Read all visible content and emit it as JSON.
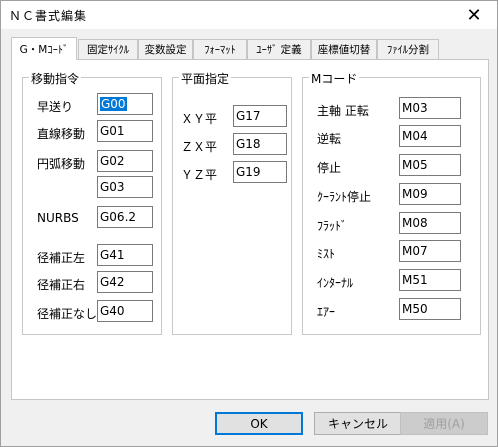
{
  "window": {
    "title": "ＮＣ書式編集"
  },
  "tabs": [
    "G・Mｺｰﾄﾞ",
    "固定ｻｲｸﾙ",
    "変数設定",
    "ﾌｫｰﾏｯﾄ",
    "ﾕｰｻﾞ 定義",
    "座標値切替",
    "ﾌｧｲﾙ分割"
  ],
  "movement": {
    "legend": "移動指令",
    "rapid": {
      "label": "早送り",
      "value": "G00"
    },
    "linear": {
      "label": "直線移動",
      "value": "G01"
    },
    "arc": {
      "label": "円弧移動",
      "value1": "G02",
      "value2": "G03"
    },
    "nurbs": {
      "label": "NURBS",
      "value": "G06.2"
    },
    "comp_left": {
      "label": "径補正左",
      "value": "G41"
    },
    "comp_right": {
      "label": "径補正右",
      "value": "G42"
    },
    "comp_none": {
      "label": "径補正なし",
      "value": "G40"
    }
  },
  "plane": {
    "legend": "平面指定",
    "xy": {
      "label": "ＸＹ平",
      "value": "G17"
    },
    "zx": {
      "label": "ＺＸ平",
      "value": "G18"
    },
    "yz": {
      "label": "ＹＺ平",
      "value": "G19"
    }
  },
  "mcode": {
    "legend": "Mコード",
    "spindle_cw": {
      "label": "主軸 正転",
      "value": "M03"
    },
    "spindle_ccw": {
      "label": "逆転",
      "value": "M04"
    },
    "stop": {
      "label": "停止",
      "value": "M05"
    },
    "coolant_stop": {
      "label": "ｸｰﾗﾝﾄ停止",
      "value": "M09"
    },
    "flood": {
      "label": "ﾌﾗｯﾄﾞ",
      "value": "M08"
    },
    "mist": {
      "label": "ﾐｽﾄ",
      "value": "M07"
    },
    "internal": {
      "label": "ｲﾝﾀｰﾅﾙ",
      "value": "M51"
    },
    "air": {
      "label": "ｴｱｰ",
      "value": "M50"
    }
  },
  "buttons": {
    "ok": "OK",
    "cancel": "キャンセル",
    "apply": "適用(A)"
  }
}
